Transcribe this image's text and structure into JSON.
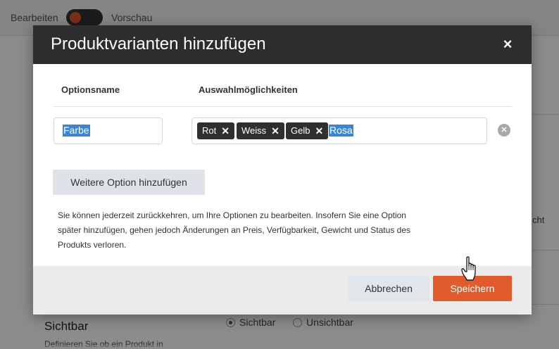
{
  "background": {
    "edit_label": "Bearbeiten",
    "preview_label": "Vorschau",
    "side_text": "cht",
    "visible_section_title": "Sichtbar",
    "visible_section_subtitle": "Definieren Sie ob ein Produkt in",
    "radio_visible": "Sichtbar",
    "radio_invisible": "Unsichtbar"
  },
  "modal": {
    "title": "Produktvarianten hinzufügen",
    "close_icon": "×",
    "column_option_name": "Optionsname",
    "column_choices": "Auswahlmöglichkeiten",
    "option_name_value": "Farbe",
    "tags": [
      "Rot",
      "Weiss",
      "Gelb"
    ],
    "tag_remove_icon": "✕",
    "choices_input_value": "Rosa",
    "row_remove_icon": "✕",
    "add_option_label": "Weitere Option hinzufügen",
    "info_line_1": "Sie können jederzeit zurückkehren, um Ihre Optionen zu bearbeiten. Insofern Sie eine Option",
    "info_line_2": "später hinzufügen, gehen jedoch Änderungen an Preis, Verfügbarkeit, Gewicht und Status des",
    "info_line_3": "Produkts verloren.",
    "cancel_label": "Abbrechen",
    "save_label": "Speichern"
  },
  "colors": {
    "header_bg": "#2d2d2d",
    "save_button": "#e15b2d",
    "selection_highlight": "#3a86d6",
    "tag_bg": "#2f2f2f"
  }
}
